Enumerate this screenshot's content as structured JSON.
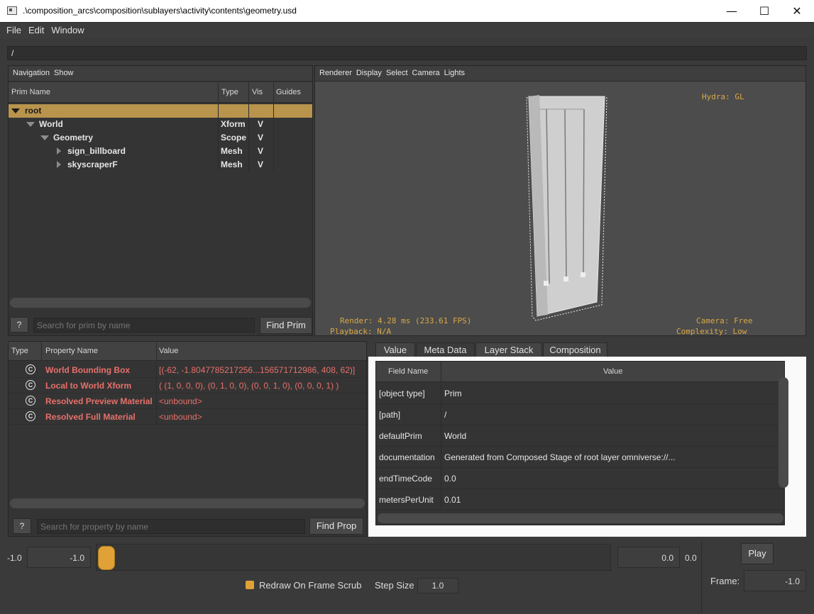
{
  "window": {
    "title": ".\\composition_arcs\\composition\\sublayers\\activity\\contents\\geometry.usd",
    "minimize_glyph": "—",
    "maximize_glyph": "☐",
    "close_glyph": "✕"
  },
  "menu": [
    "File",
    "Edit",
    "Window"
  ],
  "path_bar": {
    "value": "/"
  },
  "navigation": {
    "toolbar": [
      "Navigation",
      "Show"
    ],
    "columns": [
      "Prim Name",
      "Type",
      "Vis",
      "Guides"
    ],
    "rows": [
      {
        "name": "root",
        "type": "",
        "vis": "",
        "selected": true,
        "expand": "expanded"
      },
      {
        "name": "World",
        "type": "Xform",
        "vis": "V",
        "selected": false,
        "expand": "expanded"
      },
      {
        "name": "Geometry",
        "type": "Scope",
        "vis": "V",
        "selected": false,
        "expand": "expanded"
      },
      {
        "name": "sign_billboard",
        "type": "Mesh",
        "vis": "V",
        "selected": false,
        "expand": "collapsed"
      },
      {
        "name": "skyscraperF",
        "type": "Mesh",
        "vis": "V",
        "selected": false,
        "expand": "collapsed"
      }
    ],
    "help_label": "?",
    "search_placeholder": "Search for prim by name",
    "find_label": "Find Prim"
  },
  "viewport": {
    "toolbar": [
      "Renderer",
      "Display",
      "Select",
      "Camera",
      "Lights"
    ],
    "hud": {
      "renderer": "Hydra: GL",
      "render_stats": "Render: 4.28 ms (233.61 FPS)",
      "playback": "Playback: N/A",
      "camera": "Camera: Free",
      "complexity": "Complexity: Low"
    }
  },
  "properties": {
    "columns": [
      "Type",
      "Property Name",
      "Value"
    ],
    "rows": [
      {
        "icon": "C",
        "name": "World Bounding Box",
        "value": "[(-62, -1.8047785217256...156571712986, 408, 62)]"
      },
      {
        "icon": "C",
        "name": "Local to World Xform",
        "value": "( (1, 0, 0, 0), (0, 1, 0, 0), (0, 0, 1, 0), (0, 0, 0, 1) )"
      },
      {
        "icon": "C",
        "name": "Resolved Preview Material",
        "value": "<unbound>"
      },
      {
        "icon": "C",
        "name": "Resolved Full Material",
        "value": "<unbound>"
      }
    ],
    "help_label": "?",
    "search_placeholder": "Search for property by name",
    "find_label": "Find Prop"
  },
  "metadata": {
    "tabs": [
      "Value",
      "Meta Data",
      "Layer Stack",
      "Composition"
    ],
    "active_tab": "Meta Data",
    "columns": [
      "Field Name",
      "Value"
    ],
    "rows": [
      {
        "field": "[object type]",
        "value": "Prim"
      },
      {
        "field": "[path]",
        "value": "/"
      },
      {
        "field": "defaultPrim",
        "value": "World"
      },
      {
        "field": "documentation",
        "value": "Generated from Composed Stage of root layer omniverse://..."
      },
      {
        "field": "endTimeCode",
        "value": "0.0"
      },
      {
        "field": "metersPerUnit",
        "value": "0.01"
      }
    ]
  },
  "timeline": {
    "range_start_label": "-1.0",
    "start_field": "-1.0",
    "end_field": "0.0",
    "range_end_label": "0.0",
    "play_label": "Play",
    "redraw_label": "Redraw On Frame Scrub",
    "redraw_checked": true,
    "step_size_label": "Step Size",
    "step_size_value": "1.0",
    "frame_label": "Frame:",
    "frame_value": "-1.0",
    "accent_color": "#e0a236"
  }
}
